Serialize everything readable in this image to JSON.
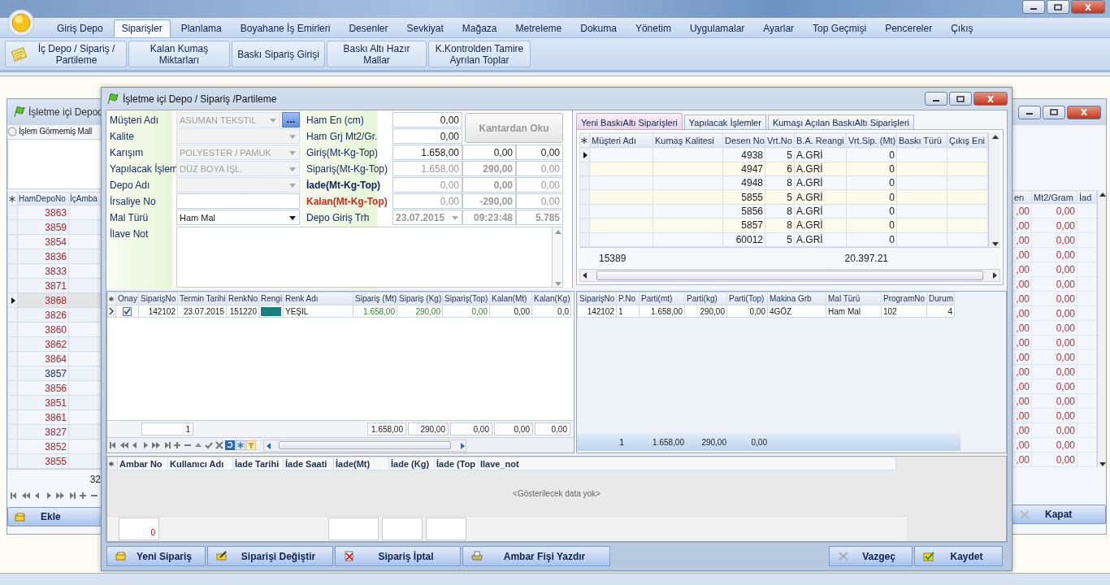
{
  "menu": [
    {
      "label": "Giriş Depo",
      "selected": false
    },
    {
      "label": "Siparişler",
      "selected": true
    },
    {
      "label": "Planlama",
      "selected": false
    },
    {
      "label": "Boyahane İş Emirleri",
      "selected": false
    },
    {
      "label": "Desenler",
      "selected": false
    },
    {
      "label": "Sevkiyat",
      "selected": false
    },
    {
      "label": "Mağaza",
      "selected": false
    },
    {
      "label": "Metreleme",
      "selected": false
    },
    {
      "label": "Dokuma",
      "selected": false
    },
    {
      "label": "Yönetim",
      "selected": false
    },
    {
      "label": "Uygulamalar",
      "selected": false
    },
    {
      "label": "Ayarlar",
      "selected": false
    },
    {
      "label": "Top Geçmişi",
      "selected": false
    },
    {
      "label": "Pencereler",
      "selected": false
    },
    {
      "label": "Çıkış",
      "selected": false
    }
  ],
  "ribbon": [
    "İç Depo / Sipariş / Partileme",
    "Kalan Kumaş Miktarları",
    "Baskı Sipariş Girişi",
    "Baskı Altı Hazır Mallar",
    "K.Kontrolden Tamire Ayrılan Toplar"
  ],
  "background_window": {
    "title": "İşletme içi Depod",
    "radio": {
      "label": "İşlem Görmemiş Mall",
      "selected": false
    },
    "left_columns": [
      "HamDepoNo",
      "İçAmba"
    ],
    "left_rows": [
      {
        "value": "3863",
        "color": "#a3262c",
        "selected": false
      },
      {
        "value": "3859",
        "color": "#a3262c",
        "selected": false
      },
      {
        "value": "3854",
        "color": "#a3262c",
        "selected": false
      },
      {
        "value": "3836",
        "color": "#a3262c",
        "selected": false
      },
      {
        "value": "3833",
        "color": "#a3262c",
        "selected": false
      },
      {
        "value": "3871",
        "color": "#a3262c",
        "selected": false
      },
      {
        "value": "3868",
        "color": "#a3262c",
        "selected": true
      },
      {
        "value": "3826",
        "color": "#a3262c",
        "selected": false
      },
      {
        "value": "3860",
        "color": "#a3262c",
        "selected": false
      },
      {
        "value": "3862",
        "color": "#a3262c",
        "selected": false
      },
      {
        "value": "3864",
        "color": "#a3262c",
        "selected": false
      },
      {
        "value": "3857",
        "color": "#1e2a7c",
        "selected": false
      },
      {
        "value": "3856",
        "color": "#a3262c",
        "selected": false
      },
      {
        "value": "3851",
        "color": "#a3262c",
        "selected": false
      },
      {
        "value": "3861",
        "color": "#a3262c",
        "selected": false
      },
      {
        "value": "3827",
        "color": "#a3262c",
        "selected": false
      },
      {
        "value": "3852",
        "color": "#a3262c",
        "selected": false
      },
      {
        "value": "3855",
        "color": "#a3262c",
        "selected": false
      }
    ],
    "left_footer": "32",
    "add_button": "Ekle",
    "right_columns": [
      "en",
      "Mt2/Gram",
      "İad"
    ],
    "right_rows": [
      [
        ",00",
        "0,00"
      ],
      [
        ",00",
        "0,00"
      ],
      [
        ",00",
        "0,00"
      ],
      [
        ",00",
        "0,00"
      ],
      [
        ",00",
        "0,00"
      ],
      [
        ",00",
        "0,00"
      ],
      [
        ",00",
        "0,00"
      ],
      [
        ",00",
        "0,00"
      ],
      [
        ",00",
        "0,00"
      ],
      [
        ",00",
        "0,00"
      ],
      [
        ",00",
        "0,00"
      ],
      [
        ",00",
        "0,00"
      ],
      [
        ",00",
        "0,00"
      ],
      [
        ",00",
        "0,00"
      ],
      [
        ",00",
        "0,00"
      ],
      [
        ",00",
        "0,00"
      ],
      [
        ",00",
        "0,00"
      ],
      [
        ",00",
        "0,00"
      ]
    ],
    "close_button": "Kapat"
  },
  "dialog": {
    "title": "İşletme içi Depo / Sipariş /Partileme",
    "left_fields": [
      {
        "label": "Müşteri Adı",
        "value": "ASUMAN TEKSTIL",
        "kind": "combo",
        "disabled": true
      },
      {
        "label": "Kalite",
        "kind": "combo",
        "disabled": true
      },
      {
        "label": "Karışım",
        "value": "POLYESTER / PAMUK",
        "kind": "combo",
        "disabled": true
      },
      {
        "label": "Yapılacak İşlem",
        "value": "DÜZ BOYA İŞL.",
        "kind": "combo",
        "disabled": true
      },
      {
        "label": "Depo Adı",
        "kind": "combo",
        "disabled": true
      },
      {
        "label": "İrsaliye No",
        "kind": "text",
        "disabled": false
      },
      {
        "label": "Mal Türü",
        "value": "Ham Mal",
        "kind": "combo",
        "disabled": false
      }
    ],
    "browse_button": "...",
    "note_label": "İlave Not",
    "right_fields": [
      {
        "label": "Ham En (cm)",
        "label_bold": false,
        "label_alert": false,
        "kind": "input",
        "values": [
          "0,00"
        ]
      },
      {
        "label": "Ham Grj Mt2/Gr.",
        "label_bold": false,
        "label_alert": false,
        "kind": "input",
        "values": [
          "0,00"
        ]
      },
      {
        "label": "Giriş(Mt-Kg-Top)",
        "label_bold": false,
        "label_alert": false,
        "kind": "input",
        "values": [
          "1.658,00",
          "0,00",
          "0,00"
        ]
      },
      {
        "label": "Sipariş(Mt-Kg-Top)",
        "label_bold": false,
        "label_alert": false,
        "kind": "readonly",
        "values": [
          "1.658,00",
          "290,00",
          "0,00"
        ]
      },
      {
        "label": "İade(Mt-Kg-Top)",
        "label_bold": true,
        "label_alert": false,
        "kind": "readonly",
        "values": [
          "0,00",
          "0,00",
          "0,00"
        ]
      },
      {
        "label": "Kalan(Mt-Kg-Top)",
        "label_bold": true,
        "label_alert": true,
        "kind": "readonly",
        "values": [
          "0,00",
          "-290,00",
          "0,00"
        ]
      },
      {
        "label": "Depo Giriş Trh",
        "label_bold": false,
        "label_alert": false,
        "kind": "date",
        "values": [
          "23.07.2015",
          "09:23:48",
          "5.785"
        ]
      }
    ],
    "kantar_button": "Kantardan Oku",
    "tabs": [
      {
        "label": "Yeni BaskıAltı Siparişleri",
        "selected": true
      },
      {
        "label": "Yapılacak İşlemler",
        "selected": false
      },
      {
        "label": "Kumaşı Açılan  BaskıAltı Siparişleri",
        "selected": false
      }
    ],
    "pattern_grid": {
      "columns": [
        "Müşteri Adı",
        "Kumaş Kalitesi",
        "Desen No",
        "Vrt.No",
        "B.A. Reangi",
        "Vrt.Sip. (Mt)",
        "Baskı Türü",
        "Çıkış Eni"
      ],
      "rows": [
        {
          "desen_no": "4938",
          "vrt_no": "5",
          "reangi": "A.GRİ",
          "vrt_sip": "0",
          "selected": true
        },
        {
          "desen_no": "4947",
          "vrt_no": "6",
          "reangi": "A.GRİ",
          "vrt_sip": "0",
          "selected": false
        },
        {
          "desen_no": "4948",
          "vrt_no": "8",
          "reangi": "A.GRİ",
          "vrt_sip": "0",
          "selected": false
        },
        {
          "desen_no": "5855",
          "vrt_no": "5",
          "reangi": "A.GRİ",
          "vrt_sip": "0",
          "selected": false
        },
        {
          "desen_no": "5856",
          "vrt_no": "8",
          "reangi": "A.GRİ",
          "vrt_sip": "0",
          "selected": false
        },
        {
          "desen_no": "5857",
          "vrt_no": "8",
          "reangi": "A.GRİ",
          "vrt_sip": "0",
          "selected": false
        },
        {
          "desen_no": "60012",
          "vrt_no": "5",
          "reangi": "A.GRİ",
          "vrt_sip": "0",
          "selected": false
        }
      ],
      "footer_count": "15389",
      "footer_total": "20.397.21"
    },
    "order_grid": {
      "columns": [
        "Onay",
        "SiparişNo",
        "Termin Tarihi",
        "RenkNo",
        "Rengi",
        "Renk Adı",
        "Sipariş (Mt)",
        "Sipariş (Kg)",
        "Sipariş(Top)",
        "Kalan(Mt)",
        "Kalan(Kg)"
      ],
      "rows": [
        {
          "selected": true,
          "approved": true,
          "color": "#17807e",
          "cells": [
            "",
            "142102",
            "23.07.2015",
            "151220",
            "",
            "YEŞIL",
            "1.658,00",
            "290,00",
            "0,00",
            "0,00",
            "0,0"
          ]
        }
      ],
      "footer_count": "1",
      "footer_totals": [
        "1.658,00",
        "290,00",
        "0,00",
        "0,00",
        "0,00"
      ]
    },
    "party_grid": {
      "columns": [
        "SiparişNo",
        "P.No",
        "Parti(mt)",
        "Parti(kg)",
        "Parti(Top)",
        "Makina Grb",
        "Mal Türü",
        "ProgramNo",
        "Durum"
      ],
      "rows": [
        {
          "cells": [
            "142102",
            "1",
            "1.658,00",
            "290,00",
            "0,00",
            "4GÖZ",
            "Ham Mal",
            "102",
            "4"
          ]
        }
      ],
      "footer_count": "1",
      "footer_totals": [
        "1.658,00",
        "290,00",
        "0,00"
      ]
    },
    "return_grid": {
      "columns": [
        "Ambar No",
        "Kullanıcı Adı",
        "İade Tarihi",
        "İade Saati",
        "İade(Mt)",
        "İade (Kg)",
        "İade (Top",
        "Ilave_not"
      ],
      "empty_text": "<Gösterilecek data yok>",
      "footer_count": "0"
    },
    "buttons": [
      "Yeni Sipariş",
      "Siparişi Değiştir",
      "Sipariş İptal",
      "Ambar Fişi Yazdır",
      "Vazgeç",
      "Kaydet"
    ]
  }
}
